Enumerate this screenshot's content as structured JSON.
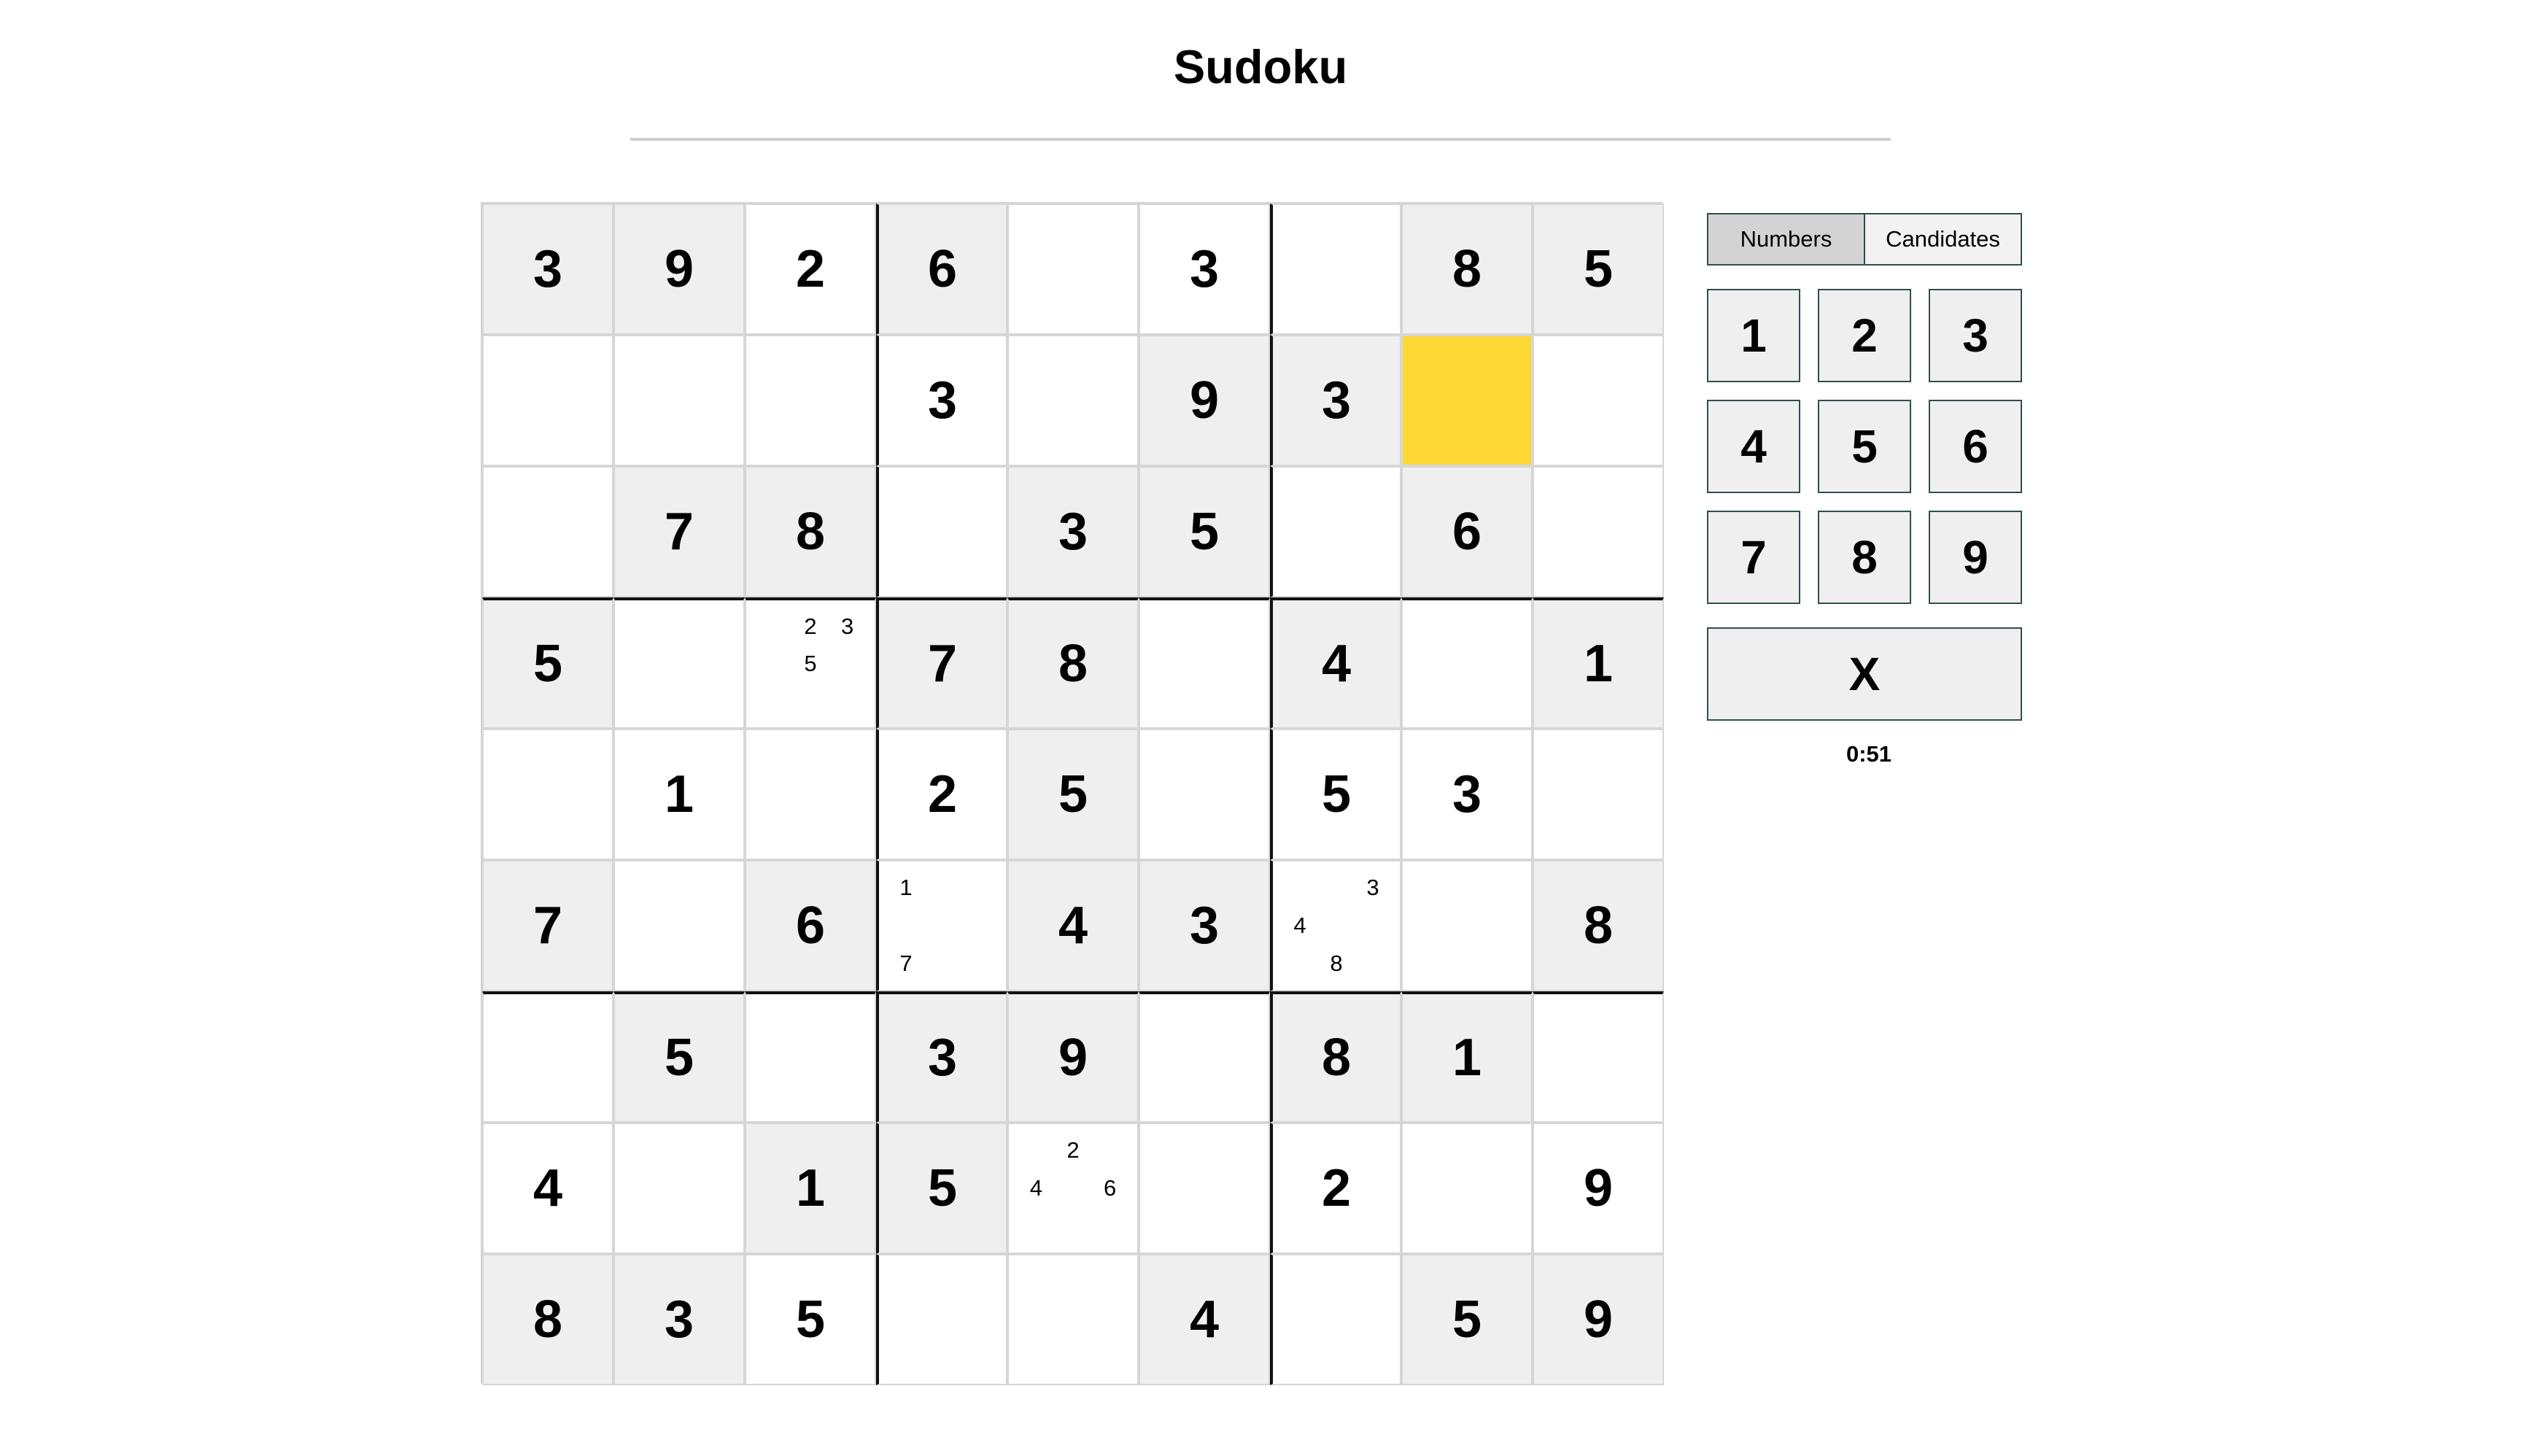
{
  "title": "Sudoku",
  "colors": {
    "given_cell_bg": "#efefef",
    "empty_cell_bg": "#ffffff",
    "selected_cell_bg": "#fdd835",
    "active_mode_bg": "#d3d3d3"
  },
  "selected_cell": {
    "row": 1,
    "col": 7
  },
  "board": [
    [
      {
        "v": "3",
        "g": true
      },
      {
        "v": "9",
        "g": true
      },
      {
        "v": "2",
        "g": false
      },
      {
        "v": "6",
        "g": true
      },
      {
        "v": "",
        "g": false
      },
      {
        "v": "3",
        "g": false
      },
      {
        "v": "",
        "g": false
      },
      {
        "v": "8",
        "g": true
      },
      {
        "v": "5",
        "g": true
      }
    ],
    [
      {
        "v": "",
        "g": false
      },
      {
        "v": "",
        "g": false
      },
      {
        "v": "",
        "g": false
      },
      {
        "v": "3",
        "g": false
      },
      {
        "v": "",
        "g": false
      },
      {
        "v": "9",
        "g": true
      },
      {
        "v": "3",
        "g": true
      },
      {
        "v": "",
        "g": false
      },
      {
        "v": "",
        "g": false
      }
    ],
    [
      {
        "v": "",
        "g": false
      },
      {
        "v": "7",
        "g": true
      },
      {
        "v": "8",
        "g": true
      },
      {
        "v": "",
        "g": false
      },
      {
        "v": "3",
        "g": true
      },
      {
        "v": "5",
        "g": true
      },
      {
        "v": "",
        "g": false
      },
      {
        "v": "6",
        "g": true
      },
      {
        "v": "",
        "g": false
      }
    ],
    [
      {
        "v": "5",
        "g": true
      },
      {
        "v": "",
        "g": false
      },
      {
        "v": "",
        "g": false,
        "c": [
          "",
          "2",
          "3",
          "",
          "5",
          "",
          "",
          "",
          ""
        ]
      },
      {
        "v": "7",
        "g": true
      },
      {
        "v": "8",
        "g": true
      },
      {
        "v": "",
        "g": false
      },
      {
        "v": "4",
        "g": true
      },
      {
        "v": "",
        "g": false
      },
      {
        "v": "1",
        "g": true
      }
    ],
    [
      {
        "v": "",
        "g": false
      },
      {
        "v": "1",
        "g": false
      },
      {
        "v": "",
        "g": false
      },
      {
        "v": "2",
        "g": false
      },
      {
        "v": "5",
        "g": true
      },
      {
        "v": "",
        "g": false
      },
      {
        "v": "5",
        "g": false
      },
      {
        "v": "3",
        "g": false
      },
      {
        "v": "",
        "g": false
      }
    ],
    [
      {
        "v": "7",
        "g": true
      },
      {
        "v": "",
        "g": false
      },
      {
        "v": "6",
        "g": true
      },
      {
        "v": "",
        "g": false,
        "c": [
          "1",
          "",
          "",
          "",
          "",
          "",
          "7",
          "",
          ""
        ]
      },
      {
        "v": "4",
        "g": true
      },
      {
        "v": "3",
        "g": true
      },
      {
        "v": "",
        "g": false,
        "c": [
          "",
          "",
          "3",
          "4",
          "",
          "",
          "",
          "8",
          ""
        ]
      },
      {
        "v": "",
        "g": false
      },
      {
        "v": "8",
        "g": true
      }
    ],
    [
      {
        "v": "",
        "g": false
      },
      {
        "v": "5",
        "g": true
      },
      {
        "v": "",
        "g": false
      },
      {
        "v": "3",
        "g": true
      },
      {
        "v": "9",
        "g": true
      },
      {
        "v": "",
        "g": false
      },
      {
        "v": "8",
        "g": true
      },
      {
        "v": "1",
        "g": true
      },
      {
        "v": "",
        "g": false
      }
    ],
    [
      {
        "v": "4",
        "g": false
      },
      {
        "v": "",
        "g": false
      },
      {
        "v": "1",
        "g": true
      },
      {
        "v": "5",
        "g": true
      },
      {
        "v": "",
        "g": false,
        "c": [
          "",
          "2",
          "",
          "4",
          "",
          "6",
          "",
          "",
          ""
        ]
      },
      {
        "v": "",
        "g": false
      },
      {
        "v": "2",
        "g": false
      },
      {
        "v": "",
        "g": false
      },
      {
        "v": "9",
        "g": false
      }
    ],
    [
      {
        "v": "8",
        "g": true
      },
      {
        "v": "3",
        "g": true
      },
      {
        "v": "5",
        "g": false
      },
      {
        "v": "",
        "g": false
      },
      {
        "v": "",
        "g": false
      },
      {
        "v": "4",
        "g": true
      },
      {
        "v": "",
        "g": false
      },
      {
        "v": "5",
        "g": true
      },
      {
        "v": "9",
        "g": true
      }
    ]
  ],
  "controls": {
    "modes": [
      {
        "label": "Numbers",
        "active": true
      },
      {
        "label": "Candidates",
        "active": false
      }
    ],
    "numbers": [
      "1",
      "2",
      "3",
      "4",
      "5",
      "6",
      "7",
      "8",
      "9"
    ],
    "clear_label": "X",
    "timer": "0:51"
  }
}
